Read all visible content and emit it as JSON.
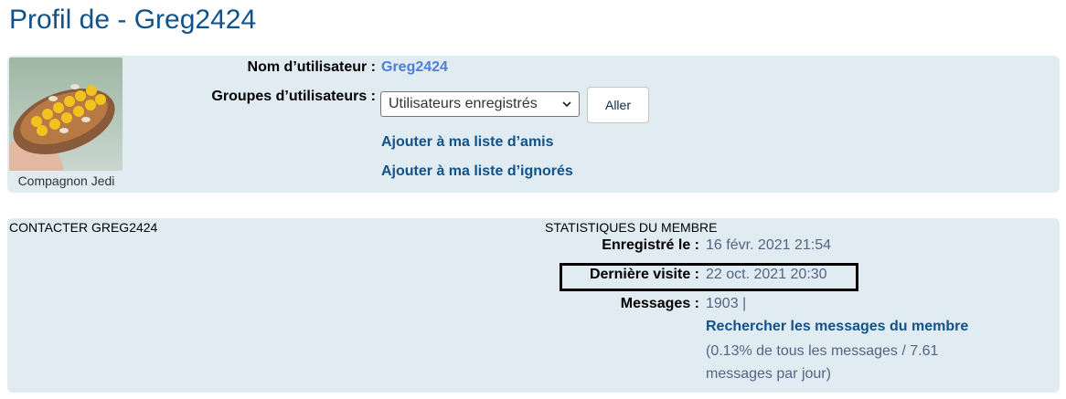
{
  "page": {
    "title": "Profil de - Greg2424"
  },
  "profile": {
    "rank": "Compagnon Jedi",
    "username_label": "Nom d’utilisateur :",
    "username": "Greg2424",
    "groups_label": "Groupes d’utilisateurs :",
    "groups_selected": "Utilisateurs enregistrés",
    "go_button": "Aller",
    "add_friend": "Ajouter à ma liste d’amis",
    "add_foe": "Ajouter à ma liste d’ignorés"
  },
  "contact": {
    "heading": "CONTACTER GREG2424"
  },
  "stats": {
    "heading": "STATISTIQUES DU MEMBRE",
    "registered_label": "Enregistré le :",
    "registered_value": "16 févr. 2021 21:54",
    "last_visit_label": "Dernière visite :",
    "last_visit_value": "22 oct. 2021 20:30",
    "posts_label": "Messages :",
    "posts_value": "1903 |",
    "search_posts": "Rechercher les messages du membre",
    "posts_detail": "(0.13% de tous les messages / 7.61 messages par jour)"
  },
  "colors": {
    "title": "#105289",
    "panel_bg": "#e1ebf2",
    "link": "#105289",
    "username_link": "#4c7fd6",
    "muted_text": "#536482"
  },
  "icons": {
    "select_chevron": "chevron-down-icon"
  }
}
